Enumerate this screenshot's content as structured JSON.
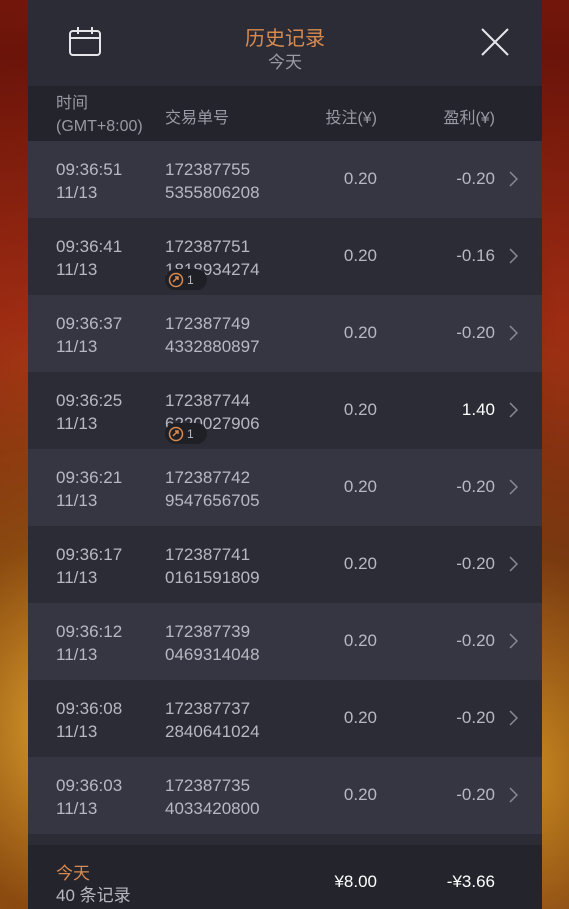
{
  "header": {
    "title": "历史记录",
    "subtitle": "今天",
    "calendar_icon": "calendar-icon",
    "close_icon": "close-icon"
  },
  "columns": {
    "time_line1": "时间",
    "time_line2": "(GMT+8:00)",
    "tx_id": "交易单号",
    "bet": "投注(¥)",
    "profit": "盈利(¥)"
  },
  "rows": [
    {
      "time": "09:36:51",
      "date": "11/13",
      "tx1": "172387755",
      "tx2": "5355806208",
      "bet": "0.20",
      "profit": "-0.20",
      "badge": null
    },
    {
      "time": "09:36:41",
      "date": "11/13",
      "tx1": "172387751",
      "tx2": "1818934274",
      "bet": "0.20",
      "profit": "-0.16",
      "badge": "1"
    },
    {
      "time": "09:36:37",
      "date": "11/13",
      "tx1": "172387749",
      "tx2": "4332880897",
      "bet": "0.20",
      "profit": "-0.20",
      "badge": null
    },
    {
      "time": "09:36:25",
      "date": "11/13",
      "tx1": "172387744",
      "tx2": "6220027906",
      "bet": "0.20",
      "profit": "1.40",
      "badge": "1"
    },
    {
      "time": "09:36:21",
      "date": "11/13",
      "tx1": "172387742",
      "tx2": "9547656705",
      "bet": "0.20",
      "profit": "-0.20",
      "badge": null
    },
    {
      "time": "09:36:17",
      "date": "11/13",
      "tx1": "172387741",
      "tx2": "0161591809",
      "bet": "0.20",
      "profit": "-0.20",
      "badge": null
    },
    {
      "time": "09:36:12",
      "date": "11/13",
      "tx1": "172387739",
      "tx2": "0469314048",
      "bet": "0.20",
      "profit": "-0.20",
      "badge": null
    },
    {
      "time": "09:36:08",
      "date": "11/13",
      "tx1": "172387737",
      "tx2": "2840641024",
      "bet": "0.20",
      "profit": "-0.20",
      "badge": null
    },
    {
      "time": "09:36:03",
      "date": "11/13",
      "tx1": "172387735",
      "tx2": "4033420800",
      "bet": "0.20",
      "profit": "-0.20",
      "badge": null
    }
  ],
  "footer": {
    "label": "今天",
    "count": "40 条记录",
    "total_bet": "¥8.00",
    "total_profit": "-¥3.66"
  },
  "colors": {
    "accent": "#d98a4e",
    "panel": "#2c2c36",
    "row_alt": "#363642"
  }
}
